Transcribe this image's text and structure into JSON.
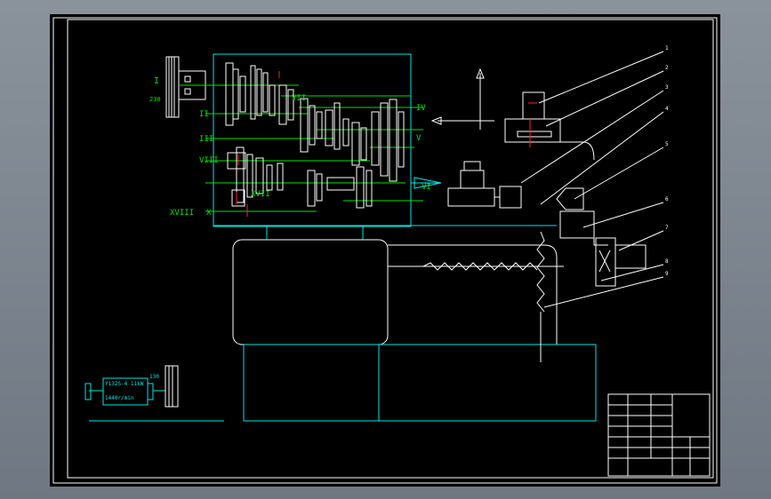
{
  "colors": {
    "background": "#000000",
    "outline": "#ffffff",
    "frame": "#00e6e6",
    "annotation": "#00e000",
    "accent": "#ff2020"
  },
  "shaft_labels": {
    "I": "I",
    "II": "II",
    "III": "III",
    "IV": "IV",
    "V": "V",
    "VI": "VI",
    "VII": "VII",
    "VIII": "VIII",
    "XVII": "XVII",
    "XVIII": "XVIII",
    "X": "X"
  },
  "motor": {
    "label": "Y132S-4 11kW",
    "speed": "1440r/min",
    "pulley_ratio": "130"
  },
  "input_pulley_label": "230",
  "leaders": [
    "1",
    "2",
    "3",
    "4",
    "5",
    "6",
    "7",
    "8",
    "9"
  ]
}
